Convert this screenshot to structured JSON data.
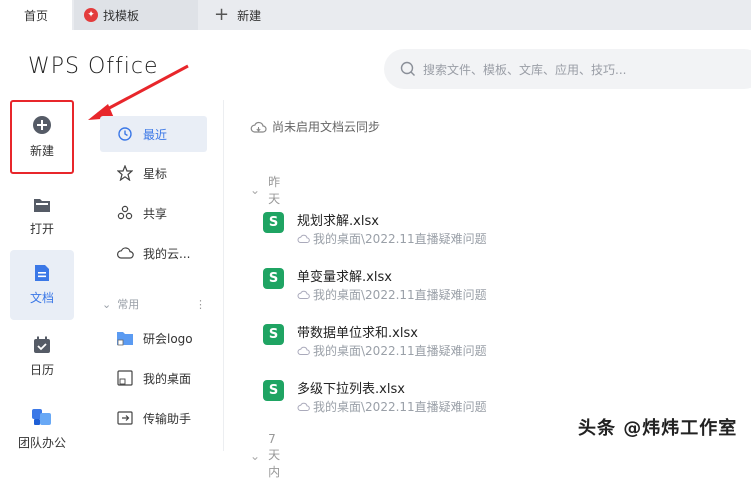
{
  "tabs": {
    "home": "首页",
    "templates": "找模板",
    "new": "新建"
  },
  "brand": "WPS Office",
  "search": {
    "placeholder": "搜索文件、模板、文库、应用、技巧..."
  },
  "leftnav": {
    "new": "新建",
    "open": "打开",
    "docs": "文档",
    "calendar": "日历",
    "team": "团队办公"
  },
  "subnav": {
    "recent": "最近",
    "starred": "星标",
    "shared": "共享",
    "cloud": "我的云...",
    "common_header": "常用",
    "folder": "研会logo",
    "desktop": "我的桌面",
    "transfer": "传输助手"
  },
  "main": {
    "sync_notice": "尚未启用文档云同步",
    "group_yesterday": "昨天",
    "group_7days": "7天内",
    "files": [
      {
        "name": "规划求解.xlsx",
        "path": "我的桌面\\2022.11直播疑难问题"
      },
      {
        "name": "单变量求解.xlsx",
        "path": "我的桌面\\2022.11直播疑难问题"
      },
      {
        "name": "带数据单位求和.xlsx",
        "path": "我的桌面\\2022.11直播疑难问题"
      },
      {
        "name": "多级下拉列表.xlsx",
        "path": "我的桌面\\2022.11直播疑难问题"
      }
    ],
    "file_icon_letter": "S"
  },
  "watermark": "头条 @炜炜工作室",
  "colors": {
    "accent": "#3b78e7",
    "highlight_box": "#e8262b",
    "sheet_icon": "#1fa463"
  }
}
